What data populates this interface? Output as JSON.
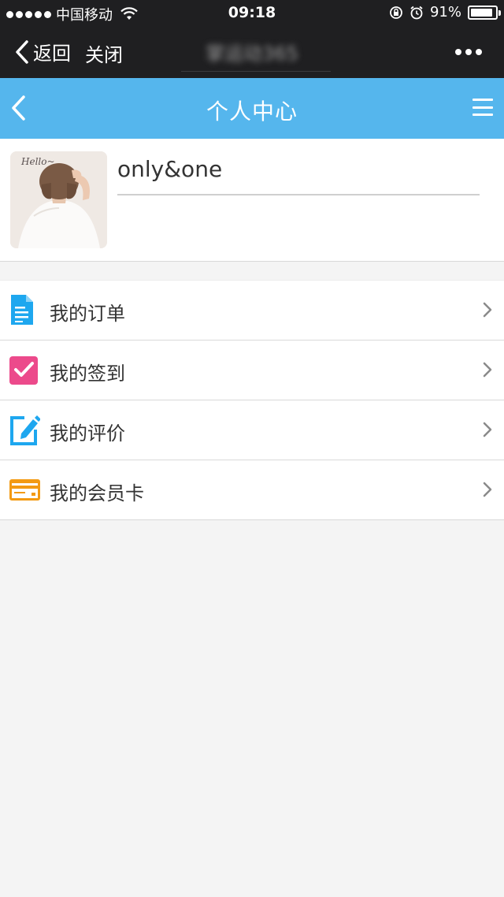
{
  "status_bar": {
    "carrier": "中国移动",
    "time": "09:18",
    "battery_percent": "91%",
    "battery_level": 0.91
  },
  "wechat_bar": {
    "back_label": "返回",
    "close_label": "关闭",
    "page_title": "掌运动365"
  },
  "header": {
    "title": "个人中心"
  },
  "profile": {
    "username": "only&one",
    "avatar_caption": "Hello~"
  },
  "menu": {
    "items": [
      {
        "label": "我的订单",
        "icon": "document-icon",
        "color": "#1ea7ef"
      },
      {
        "label": "我的签到",
        "icon": "checkbox-icon",
        "color": "#ec4a8b"
      },
      {
        "label": "我的评价",
        "icon": "edit-icon",
        "color": "#1ea7ef"
      },
      {
        "label": "我的会员卡",
        "icon": "card-icon",
        "color": "#f39a12"
      }
    ]
  },
  "colors": {
    "header_bg": "#55b6ed",
    "top_bar_bg": "#1f1f21",
    "page_bg": "#f4f4f4"
  }
}
